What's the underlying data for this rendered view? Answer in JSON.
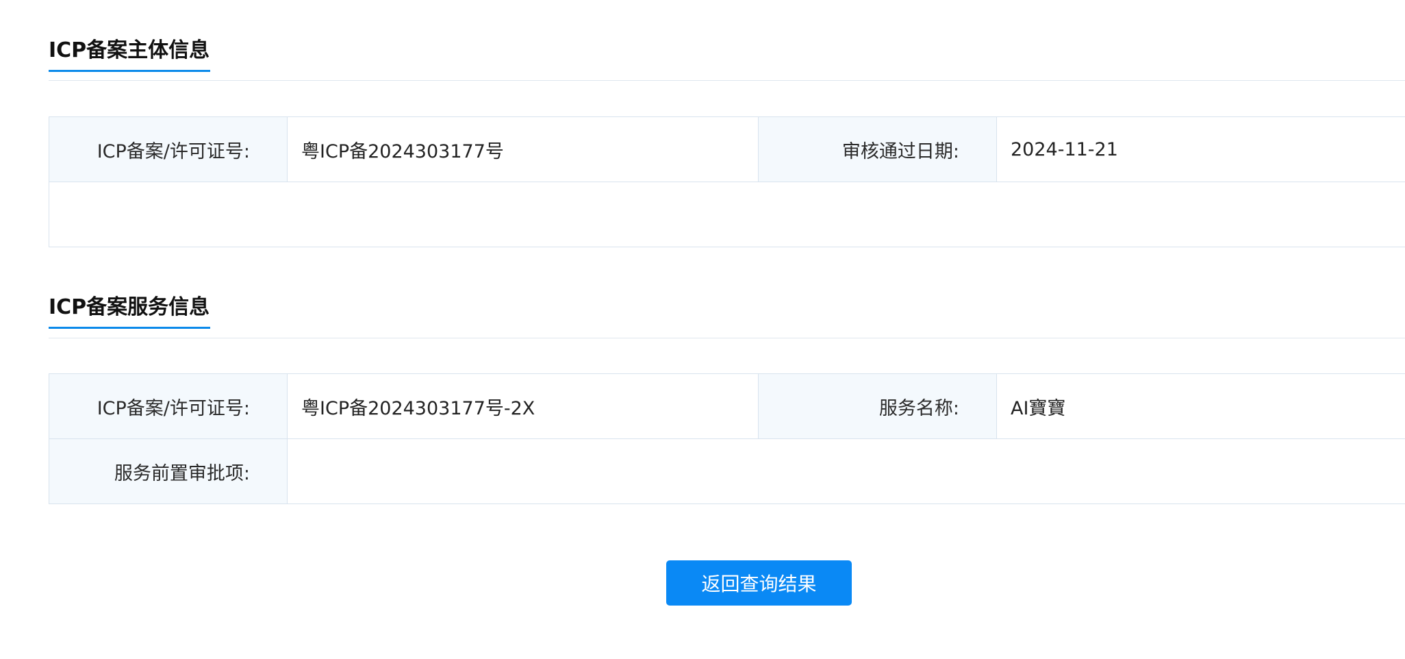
{
  "subject_section": {
    "title": "ICP备案主体信息",
    "rows": [
      {
        "label1": "ICP备案/许可证号:",
        "value1": "粤ICP备2024303177号",
        "label2": "审核通过日期:",
        "value2": "2024-11-21"
      }
    ]
  },
  "service_section": {
    "title": "ICP备案服务信息",
    "row1": {
      "label1": "ICP备案/许可证号:",
      "value1": "粤ICP备2024303177号-2X",
      "label2": "服务名称:",
      "value2": "AI寶寶"
    },
    "row2": {
      "label": "服务前置审批项:",
      "value": ""
    }
  },
  "actions": {
    "return_label": "返回查询结果"
  },
  "colors": {
    "accent": "#0a89f5",
    "label_bg": "#f4f9fd",
    "border": "#d8e3ee"
  }
}
